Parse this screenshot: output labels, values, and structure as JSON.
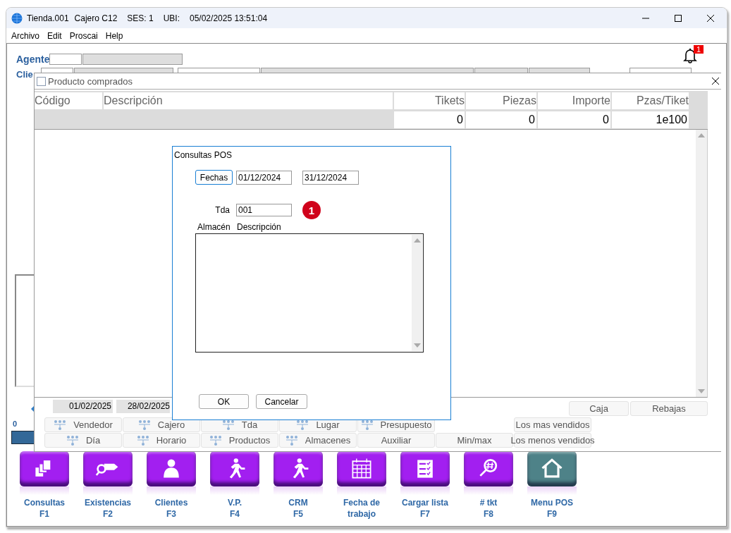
{
  "window": {
    "title_segments": [
      "Tienda.001",
      "Cajero C12",
      "SES: 1",
      "UBI:",
      "05/02/2025 13:51:04"
    ]
  },
  "menu": [
    {
      "label": "Archivo"
    },
    {
      "label": "Edit"
    },
    {
      "label": "Proscai"
    },
    {
      "label": "Help"
    }
  ],
  "header": {
    "agent_label": "Agente",
    "client_label": "Clie"
  },
  "notifications": {
    "badge": "1"
  },
  "left_panel": {
    "counter": "0"
  },
  "products_window": {
    "title": "Producto comprados",
    "columns": [
      "Código",
      "Descripción",
      "Tikets",
      "Piezas",
      "Importe",
      "Pzas/Tiket"
    ],
    "totals": [
      "0",
      "0",
      "0",
      "1e100"
    ],
    "date_from": "01/02/2025",
    "date_to": "28/02/2025",
    "side_buttons": [
      "Caja",
      "Rebajas"
    ],
    "group_rows": [
      [
        {
          "label": "Vendedor",
          "kind": "grouping"
        },
        {
          "label": "Cajero",
          "kind": "grouping"
        },
        {
          "label": "Tda",
          "kind": "grouping"
        },
        {
          "label": "Lugar",
          "kind": "grouping"
        },
        {
          "label": "Presupuesto",
          "kind": "grouping"
        },
        {
          "label": "Los mas vendidos",
          "kind": "report"
        }
      ],
      [
        {
          "label": "Día",
          "kind": "grouping"
        },
        {
          "label": "Horario",
          "kind": "grouping"
        },
        {
          "label": "Productos",
          "kind": "grouping"
        },
        {
          "label": "Almacenes",
          "kind": "grouping"
        },
        {
          "label": "Auxiliar",
          "kind": "report"
        },
        {
          "label": "Min/max",
          "kind": "report"
        },
        {
          "label": "Los menos vendidos",
          "kind": "report"
        }
      ]
    ]
  },
  "dialog": {
    "title": "Consultas POS",
    "dates_button": "Fechas",
    "date_from": "01/12/2024",
    "date_to": "31/12/2024",
    "store_label": "Tda",
    "store_value": "001",
    "step_badge": "1",
    "list_columns": [
      "Almacén",
      "Descripción"
    ],
    "buttons": [
      "OK",
      "Cancelar"
    ]
  },
  "toolbar": [
    {
      "label": "Consultas",
      "key": "F1",
      "color": "#a21ff0"
    },
    {
      "label": "Existencias",
      "key": "F2",
      "color": "#a21ff0"
    },
    {
      "label": "Clientes",
      "key": "F3",
      "color": "#a21ff0"
    },
    {
      "label": "V.P.",
      "key": "F4",
      "color": "#a21ff0"
    },
    {
      "label": "CRM",
      "key": "F5",
      "color": "#a21ff0"
    },
    {
      "label": "Fecha de trabajo",
      "color": "#a21ff0"
    },
    {
      "label": "Cargar lista",
      "key": "F7",
      "color": "#a21ff0"
    },
    {
      "label": "# tkt",
      "key": "F8",
      "color": "#a21ff0"
    },
    {
      "label": "Menu POS",
      "key": "F9",
      "color": "#4e8288"
    }
  ]
}
